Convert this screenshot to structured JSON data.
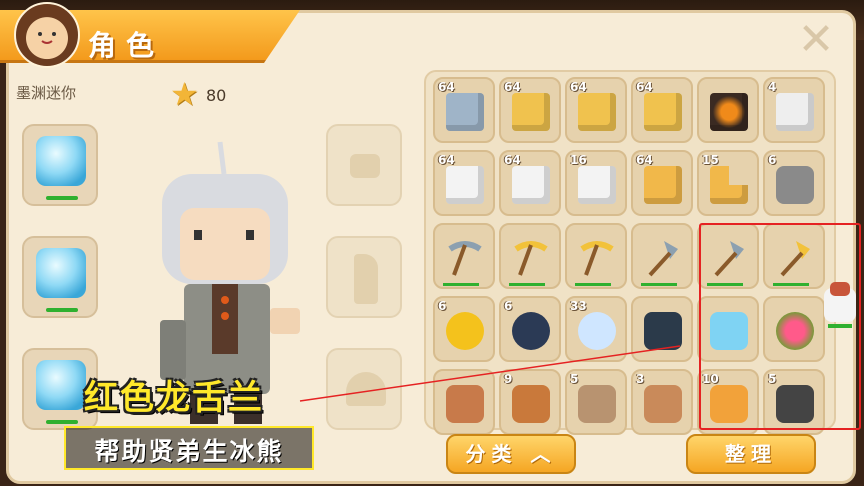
{
  "header": {
    "title": "角色",
    "close_icon": "close-x-icon"
  },
  "player": {
    "name": "墨渊迷你",
    "star_count": "80"
  },
  "equipment": [
    {
      "slot": "helmet",
      "icon": "ice-helmet-icon",
      "durability": 1.0
    },
    {
      "slot": "chest",
      "icon": "ice-chestplate-icon",
      "durability": 1.0
    },
    {
      "slot": "legs",
      "icon": "ice-leggings-icon",
      "durability": 1.0
    }
  ],
  "inventory": [
    {
      "count": "64",
      "icon": "stone-block-icon",
      "color": "#9fb4c8"
    },
    {
      "count": "64",
      "icon": "sand-block-icon",
      "color": "#f0c24e"
    },
    {
      "count": "64",
      "icon": "sand-block-icon",
      "color": "#f0c24e"
    },
    {
      "count": "64",
      "icon": "sand-block-icon",
      "color": "#f0c24e"
    },
    {
      "count": "",
      "icon": "lava-block-icon",
      "color": "#3a2a22"
    },
    {
      "count": "4",
      "icon": "white-brick-icon",
      "color": "#eeeeee"
    },
    {
      "count": "64",
      "icon": "white-block-icon",
      "color": "#f3f3f3"
    },
    {
      "count": "64",
      "icon": "white-block-icon",
      "color": "#f3f3f3"
    },
    {
      "count": "16",
      "icon": "white-block-icon",
      "color": "#f3f3f3"
    },
    {
      "count": "64",
      "icon": "wood-plank-icon",
      "color": "#f1b84a"
    },
    {
      "count": "15",
      "icon": "wood-stairs-icon",
      "color": "#f1b84a"
    },
    {
      "count": "6",
      "icon": "iron-fence-icon",
      "color": "#8a8a8a"
    },
    {
      "count": "",
      "icon": "stone-pickaxe-icon",
      "color": "#8ca0b0"
    },
    {
      "count": "",
      "icon": "gold-pickaxe-icon",
      "color": "#f2c23a"
    },
    {
      "count": "",
      "icon": "gold-pickaxe-icon",
      "color": "#f2c23a"
    },
    {
      "count": "",
      "icon": "stone-shovel-icon",
      "color": "#8ca0b0"
    },
    {
      "count": "",
      "icon": "stone-shovel-icon",
      "color": "#8ca0b0"
    },
    {
      "count": "",
      "icon": "gold-shovel-icon",
      "color": "#f2c23a"
    },
    {
      "count": "6",
      "icon": "gold-coin-icon",
      "color": "#f4c21c"
    },
    {
      "count": "6",
      "icon": "dark-gem-icon",
      "color": "#2b3a55"
    },
    {
      "count": "33",
      "icon": "winged-orb-icon",
      "color": "#cfe6ff"
    },
    {
      "count": "",
      "icon": "dark-cloak-icon",
      "color": "#2b3a4a"
    },
    {
      "count": "",
      "icon": "ice-boots-icon",
      "color": "#7fd3f3"
    },
    {
      "count": "",
      "icon": "red-dragon-tongue-orchid-icon",
      "color": "#e23a6a"
    },
    {
      "count": "",
      "icon": "grilled-steak-icon",
      "color": "#c87a4a"
    },
    {
      "count": "9",
      "icon": "roast-drumstick-icon",
      "color": "#c9793b"
    },
    {
      "count": "5",
      "icon": "bread-slice-icon",
      "color": "#b89370"
    },
    {
      "count": "3",
      "icon": "ribs-icon",
      "color": "#c98a5a"
    },
    {
      "count": "10",
      "icon": "bread-loaf-icon",
      "color": "#f2a23a"
    },
    {
      "count": "5",
      "icon": "coal-ore-icon",
      "color": "#444444"
    }
  ],
  "buttons": {
    "sort_label": "分类 ︿",
    "organize_label": "整理"
  },
  "captions": {
    "line1": "红色龙舌兰",
    "line2": "帮助贤弟生冰熊"
  },
  "colors": {
    "accent": "#f5a623",
    "highlight": "#e52222",
    "caption": "#ffe82a"
  }
}
